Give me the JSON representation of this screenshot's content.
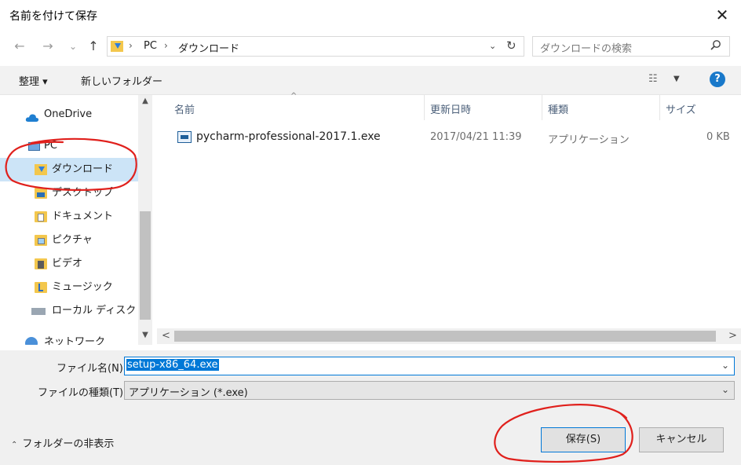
{
  "window": {
    "title": "名前を付けて保存",
    "close_glyph": "✕"
  },
  "nav": {
    "back": "←",
    "forward": "→",
    "recent": "⌄",
    "up": "↑",
    "breadcrumb": [
      "PC",
      "ダウンロード"
    ],
    "breadcrumb_sep": "›",
    "dropdown": "⌄",
    "refresh": "↻"
  },
  "search": {
    "placeholder": "ダウンロードの検索",
    "icon": "search-icon"
  },
  "toolbar": {
    "organize": "整理 ▾",
    "new_folder": "新しいフォルダー",
    "view_icon": "☷",
    "view_dropdown": "▼",
    "help": "?"
  },
  "sidebar": {
    "items": [
      {
        "label": "OneDrive",
        "icon": "onedrive-cloud-icon"
      },
      {
        "label": "PC",
        "icon": "pc-icon"
      },
      {
        "label": "ダウンロード",
        "icon": "downloads-folder-icon",
        "selected": true
      },
      {
        "label": "デスクトップ",
        "icon": "desktop-folder-icon"
      },
      {
        "label": "ドキュメント",
        "icon": "documents-folder-icon"
      },
      {
        "label": "ピクチャ",
        "icon": "pictures-folder-icon"
      },
      {
        "label": "ビデオ",
        "icon": "videos-folder-icon"
      },
      {
        "label": "ミュージック",
        "icon": "music-folder-icon"
      },
      {
        "label": "ローカル ディスク (C",
        "icon": "local-disk-icon"
      },
      {
        "label": "ネットワーク",
        "icon": "network-icon"
      }
    ],
    "scroll_up": "▲",
    "scroll_down": "▼"
  },
  "columns": {
    "name": "名前",
    "modified": "更新日時",
    "type": "種類",
    "size": "サイズ",
    "sort_indicator": "^"
  },
  "files": [
    {
      "name": "pycharm-professional-2017.1.exe",
      "modified": "2017/04/21 11:39",
      "type": "アプリケーション",
      "size": "0 KB"
    }
  ],
  "hscroll": {
    "left": "<",
    "right": ">"
  },
  "form": {
    "filename_label": "ファイル名(N):",
    "filename_value": "setup-x86_64.exe",
    "filetype_label": "ファイルの種類(T):",
    "filetype_value": "アプリケーション (*.exe)",
    "dropdown_glyph": "⌄"
  },
  "footer": {
    "hide_folders": "フォルダーの非表示",
    "hide_chevron": "⌃",
    "save": "保存(S)",
    "cancel": "キャンセル"
  },
  "colors": {
    "accent": "#0078d7",
    "selection": "#cce4f7",
    "annotation": "#e0201c"
  }
}
